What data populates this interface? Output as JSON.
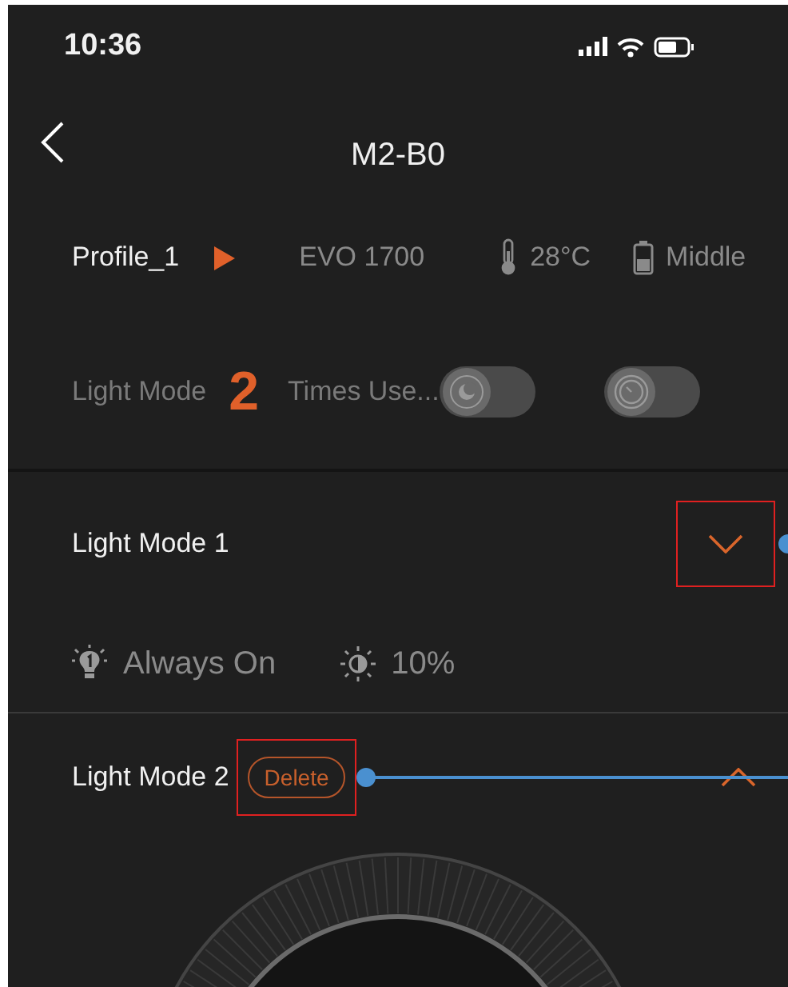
{
  "status_bar": {
    "time": "10:36"
  },
  "nav": {
    "title": "M2-B0"
  },
  "profile": {
    "name": "Profile_1",
    "device": "EVO 1700",
    "temperature": "28°C",
    "battery": "Middle"
  },
  "mode_summary": {
    "label": "Light Mode",
    "count": "2",
    "times_used": "Times Use...",
    "toggles": [
      {
        "kind": "moon",
        "on": false
      },
      {
        "kind": "timer",
        "on": false
      }
    ]
  },
  "light_modes": [
    {
      "title": "Light Mode 1",
      "expanded": false,
      "chevron_highlighted": true,
      "mode": "Always On",
      "brightness": "10%"
    },
    {
      "title": "Light Mode 2",
      "expanded": true,
      "delete_highlighted": true,
      "delete_label": "Delete"
    }
  ]
}
